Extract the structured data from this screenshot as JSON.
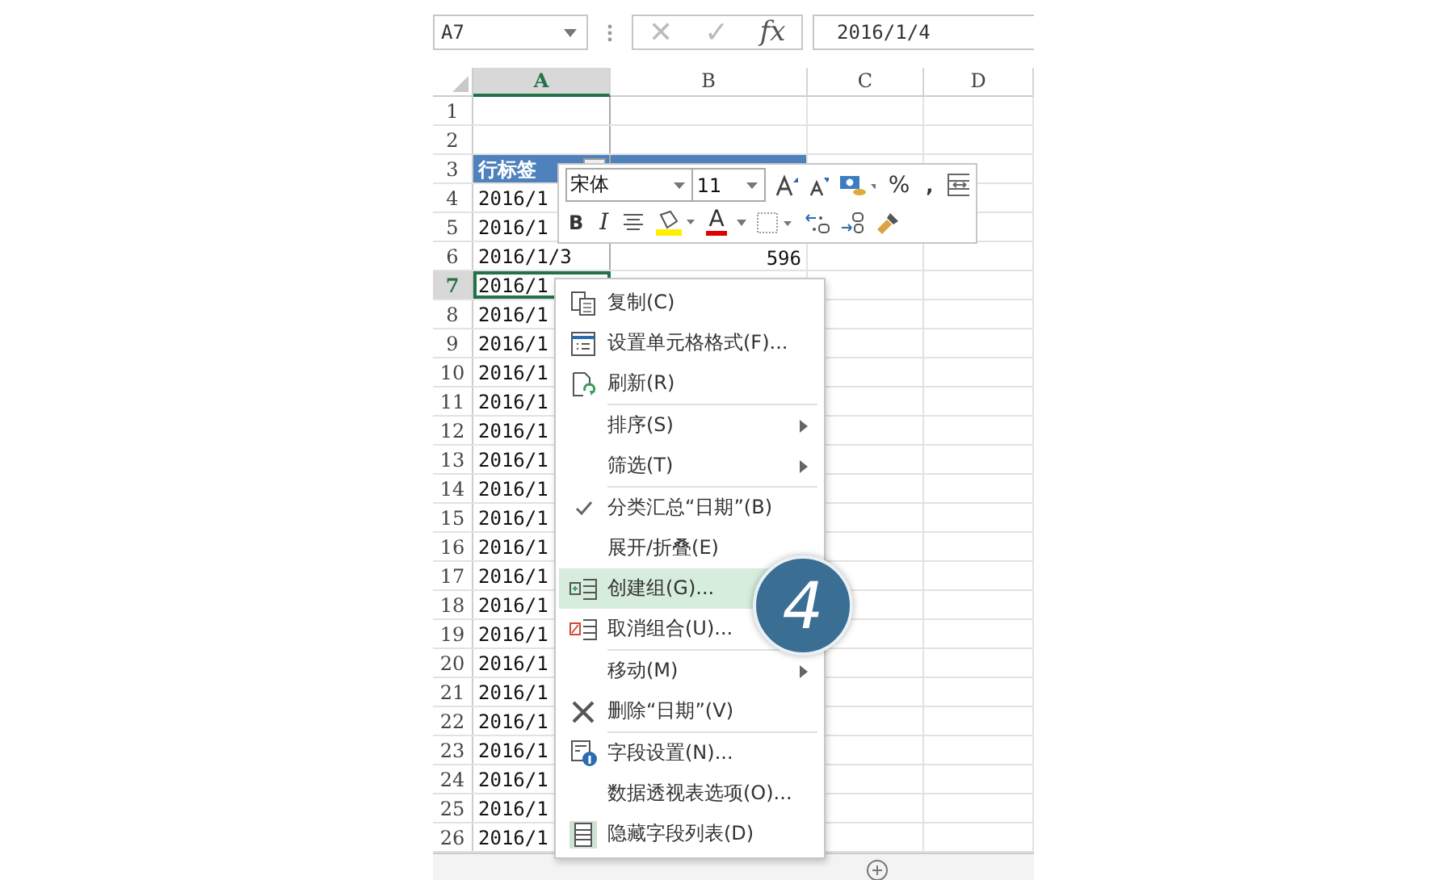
{
  "formula_bar": {
    "name_box": "A7",
    "cancel": "✕",
    "enter": "✓",
    "function": "fx",
    "value": "2016/1/4"
  },
  "columns": [
    {
      "label": "A",
      "selected": true
    },
    {
      "label": "B",
      "selected": false
    },
    {
      "label": "C",
      "selected": false
    },
    {
      "label": "D",
      "selected": false
    }
  ],
  "rows": [
    {
      "number": "1",
      "a": "",
      "b": "",
      "selected": false,
      "kind": "plain"
    },
    {
      "number": "2",
      "a": "",
      "b": "",
      "selected": false,
      "kind": "plain"
    },
    {
      "number": "3",
      "a": "行标签",
      "b": "",
      "selected": false,
      "kind": "header"
    },
    {
      "number": "4",
      "a": "2016/1",
      "b": "",
      "selected": false,
      "kind": "plain"
    },
    {
      "number": "5",
      "a": "2016/1",
      "b": "",
      "selected": false,
      "kind": "plain"
    },
    {
      "number": "6",
      "a": "2016/1/3",
      "b": "596",
      "selected": false,
      "kind": "plain"
    },
    {
      "number": "7",
      "a": "2016/1",
      "b": "",
      "selected": true,
      "kind": "plain"
    },
    {
      "number": "8",
      "a": "2016/1",
      "b": "",
      "selected": false,
      "kind": "plain"
    },
    {
      "number": "9",
      "a": "2016/1",
      "b": "",
      "selected": false,
      "kind": "plain"
    },
    {
      "number": "10",
      "a": "2016/1",
      "b": "",
      "selected": false,
      "kind": "plain"
    },
    {
      "number": "11",
      "a": "2016/1",
      "b": "",
      "selected": false,
      "kind": "plain"
    },
    {
      "number": "12",
      "a": "2016/1",
      "b": "",
      "selected": false,
      "kind": "plain"
    },
    {
      "number": "13",
      "a": "2016/1",
      "b": "",
      "selected": false,
      "kind": "plain"
    },
    {
      "number": "14",
      "a": "2016/1",
      "b": "",
      "selected": false,
      "kind": "plain"
    },
    {
      "number": "15",
      "a": "2016/1",
      "b": "",
      "selected": false,
      "kind": "plain"
    },
    {
      "number": "16",
      "a": "2016/1",
      "b": "",
      "selected": false,
      "kind": "plain"
    },
    {
      "number": "17",
      "a": "2016/1",
      "b": "",
      "selected": false,
      "kind": "plain"
    },
    {
      "number": "18",
      "a": "2016/1",
      "b": "",
      "selected": false,
      "kind": "plain"
    },
    {
      "number": "19",
      "a": "2016/1",
      "b": "",
      "selected": false,
      "kind": "plain"
    },
    {
      "number": "20",
      "a": "2016/1",
      "b": "",
      "selected": false,
      "kind": "plain"
    },
    {
      "number": "21",
      "a": "2016/1",
      "b": "",
      "selected": false,
      "kind": "plain"
    },
    {
      "number": "22",
      "a": "2016/1",
      "b": "",
      "selected": false,
      "kind": "plain"
    },
    {
      "number": "23",
      "a": "2016/1",
      "b": "",
      "selected": false,
      "kind": "plain"
    },
    {
      "number": "24",
      "a": "2016/1",
      "b": "",
      "selected": false,
      "kind": "plain"
    },
    {
      "number": "25",
      "a": "2016/1",
      "b": "",
      "selected": false,
      "kind": "plain"
    },
    {
      "number": "26",
      "a": "2016/1",
      "b": "",
      "selected": false,
      "kind": "plain"
    }
  ],
  "mini_toolbar": {
    "font": "宋体",
    "size": "11",
    "percent": "%",
    "comma": ",",
    "bold": "B",
    "italic": "I",
    "font_color": "A"
  },
  "context_menu": [
    {
      "label": "复制(C)",
      "kind": "copy",
      "selected": false
    },
    {
      "label": "设置单元格格式(F)...",
      "kind": "format",
      "selected": false
    },
    {
      "label": "刷新(R)",
      "kind": "refresh",
      "selected": false
    },
    {
      "label": "排序(S)",
      "kind": "none",
      "submenu": true,
      "selected": false,
      "separator_before": true
    },
    {
      "label": "筛选(T)",
      "kind": "none",
      "submenu": true,
      "selected": false
    },
    {
      "label": "分类汇总“日期”(B)",
      "kind": "none",
      "checked": true,
      "selected": false,
      "separator_before": true
    },
    {
      "label": "展开/折叠(E)",
      "kind": "none",
      "selected": false
    },
    {
      "label": "创建组(G)...",
      "kind": "group",
      "selected": true
    },
    {
      "label": "取消组合(U)...",
      "kind": "ungroup",
      "selected": false
    },
    {
      "label": "移动(M)",
      "kind": "none",
      "submenu": true,
      "selected": false,
      "separator_before": true
    },
    {
      "label": "删除“日期”(V)",
      "kind": "delete",
      "selected": false
    },
    {
      "label": "字段设置(N)...",
      "kind": "settings",
      "selected": false,
      "separator_before": true
    },
    {
      "label": "数据透视表选项(O)...",
      "kind": "none",
      "selected": false
    },
    {
      "label": "隐藏字段列表(D)",
      "kind": "list",
      "selected": false
    }
  ],
  "step_badge": "4"
}
